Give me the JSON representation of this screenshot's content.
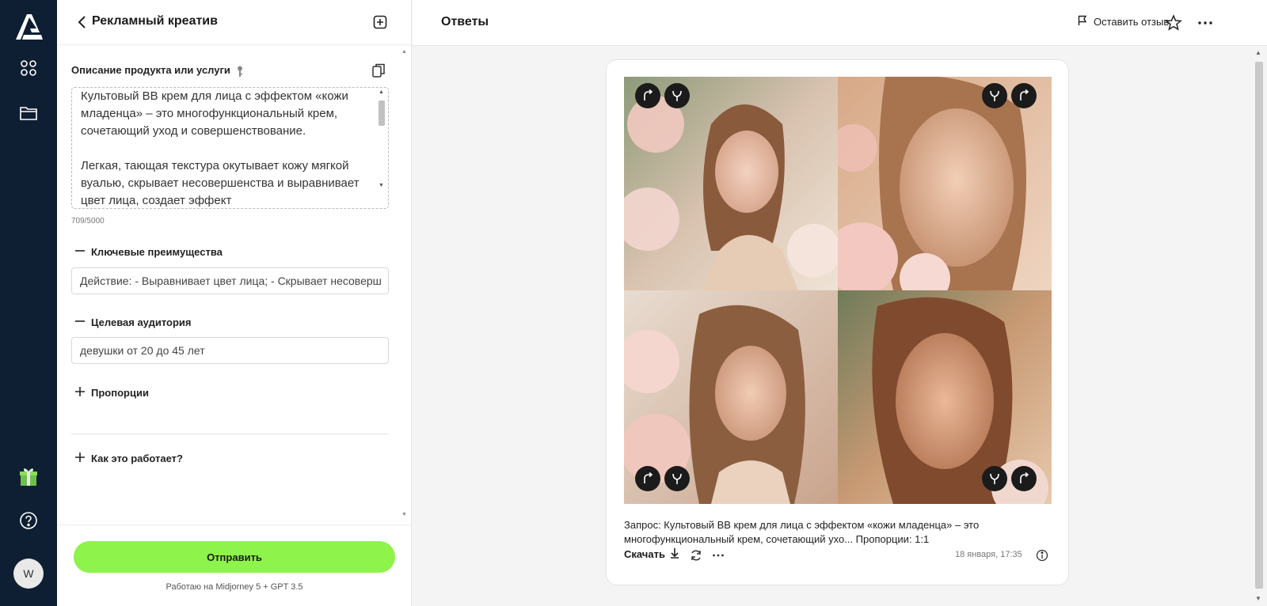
{
  "sidebar": {
    "avatar_initial": "W",
    "icons": [
      "logo-icon",
      "apps-grid-icon",
      "folder-icon",
      "gift-icon",
      "help-icon"
    ]
  },
  "panel": {
    "title": "Рекламный креатив",
    "description_label": "Описание продукта или услуги",
    "description_value": "Культовый BB крем для лица с эффектом «кожи младенца» – это многофункциональный крем, сочетающий уход и совершенствование.\n\nЛегкая, тающая текстура окутывает кожу мягкой вуалью, скрывает несовершенства и выравнивает цвет лица, создает эффект",
    "char_counter": "709/5000",
    "benefits_label": "Ключевые преимущества",
    "benefits_value": "Действие: - Выравнивает цвет лица; - Скрывает несоверш",
    "audience_label": "Целевая аудитория",
    "audience_value": "девушки от 20 до 45 лет",
    "proportions_label": "Пропорции",
    "how_label": "Как это работает?",
    "submit_label": "Отправить",
    "powered_by": "Работаю на Midjorney 5 + GPT 3.5"
  },
  "main": {
    "title": "Ответы",
    "feedback_label": "Оставить отзыв",
    "prompt_text": "Запрос: Культовый BB крем для лица с эффектом «кожи младенца» – это многофункциональный крем, сочетающий ухо... Пропорции: 1:1",
    "download_label": "Скачать",
    "timestamp": "18 января, 17:35"
  },
  "colors": {
    "rail_bg": "#0f1f33",
    "accent": "#8ef34a"
  }
}
